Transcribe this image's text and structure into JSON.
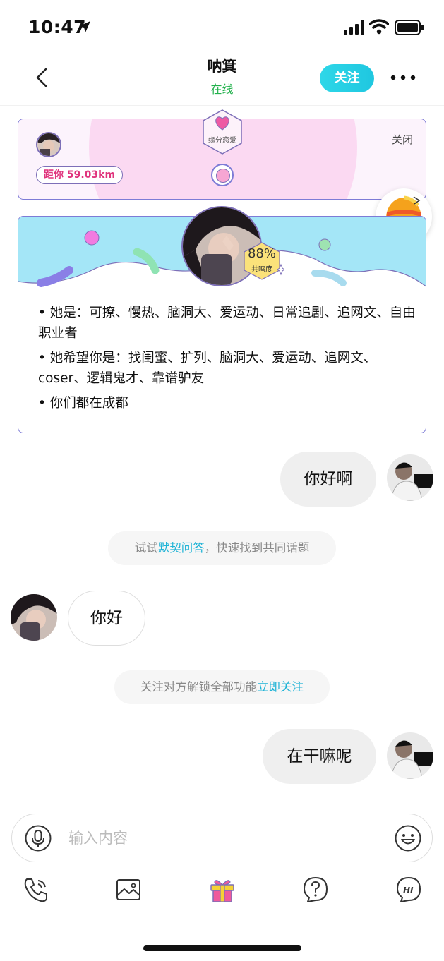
{
  "status_bar": {
    "time": "10:47",
    "icons": [
      "location-arrow-icon",
      "signal-icon",
      "wifi-icon",
      "battery-icon"
    ]
  },
  "nav": {
    "title": "呐箕",
    "status": "在线",
    "status_color": "#22b14c",
    "follow_label": "关注",
    "follow_color": "#2ed7e8"
  },
  "match_card": {
    "badge_label": "缘分恋爱",
    "distance": "距你 59.03km",
    "close_label": "关闭"
  },
  "profile_card": {
    "score": "88%",
    "score_label": "共鸣度",
    "lines": [
      "• 她是：可撩、慢热、脑洞大、爱运动、日常追剧、追网文、自由职业者",
      "• 她希望你是：找闺蜜、扩列、脑洞大、爱运动、追网文、coser、逻辑鬼才、靠谱驴友",
      "• 你们都在成都"
    ]
  },
  "messages": [
    {
      "from": "me",
      "text": "你好啊"
    },
    {
      "tip_prefix": "试试",
      "tip_link": "默契问答",
      "tip_suffix": "，快速找到共同话题"
    },
    {
      "from": "other",
      "text": "你好"
    },
    {
      "tip_prefix": "关注对方解锁全部功能",
      "tip_link": "立即关注",
      "tip_suffix": ""
    },
    {
      "from": "me",
      "text": "在干嘛呢"
    }
  ],
  "input": {
    "placeholder": "输入内容"
  },
  "toolbar": {
    "items": [
      "phone-call-icon",
      "image-icon",
      "gift-icon",
      "question-icon",
      "hi-icon"
    ]
  },
  "colors": {
    "accent": "#1fb3d6",
    "card_border": "#7d7bd6",
    "distance_text": "#e0347d"
  }
}
